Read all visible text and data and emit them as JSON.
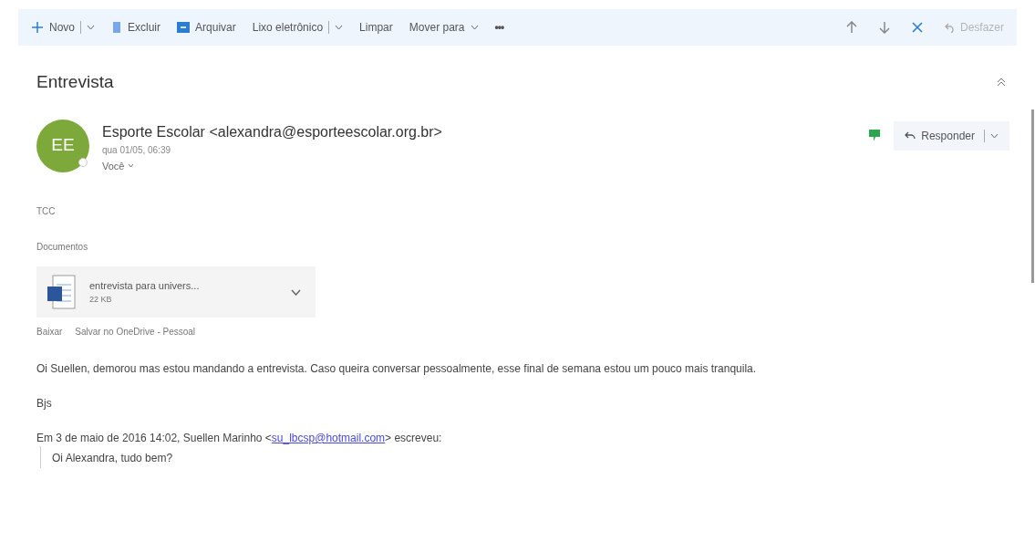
{
  "toolbar": {
    "items": [
      {
        "kind": "new",
        "label": "Novo",
        "dropdown": true,
        "disabled": false
      },
      {
        "kind": "delete",
        "label": "Excluir",
        "dropdown": false,
        "disabled": false
      },
      {
        "kind": "archive",
        "label": "Arquivar",
        "dropdown": false,
        "disabled": false
      },
      {
        "kind": "plain",
        "label": "Lixo eletrônico",
        "dropdown": true,
        "disabled": false
      },
      {
        "kind": "plain",
        "label": "Limpar",
        "dropdown": false,
        "disabled": false
      },
      {
        "kind": "chevron",
        "label": "Mover para",
        "dropdown": false,
        "disabled": false
      },
      {
        "kind": "more",
        "label": "•••",
        "dropdown": false,
        "disabled": false
      }
    ],
    "right": [
      {
        "kind": "up"
      },
      {
        "kind": "down"
      },
      {
        "kind": "close"
      },
      {
        "kind": "undo",
        "label": "Desfazer",
        "disabled": true
      }
    ]
  },
  "subject": "Entrevista",
  "message": {
    "avatar": "EE",
    "sender": "Esporte Escolar <alexandra@esporteescolar.org.br>",
    "date": "qua 01/05, 06:39",
    "to": "Você",
    "reply": "Responder",
    "lines": [
      "TCC",
      "Documentos"
    ],
    "attachment": {
      "name": "entrevista para univers...",
      "size": "22 KB"
    },
    "attachment_links": [
      "Baixar",
      "Salvar no OneDrive - Pessoal"
    ],
    "body": [
      "Oi Suellen, demorou mas estou mandando a entrevista. Caso queira conversar pessoalmente, esse final de semana estou um pouco mais tranquila.",
      "Bjs"
    ],
    "quote_header": {
      "before": "Em 3 de maio de 2016 14:02, Suellen Marinho <",
      "email": "su_lbcsp@hotmail.com",
      "after": "> escreveu:"
    },
    "quote": "Oi Alexandra, tudo bem?"
  }
}
